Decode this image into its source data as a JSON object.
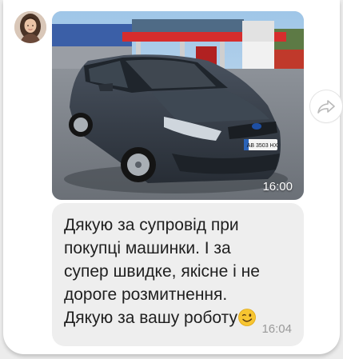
{
  "message": {
    "photo_time": "16:00",
    "text": "Дякую за супровід при\nпокупці машинки. І за\nсупер швидке, якісне і не\nдороге розмитнення.\nДякую за вашу роботу",
    "emoji": "wink-face",
    "text_time": "16:04"
  },
  "photo": {
    "license_plate": "АВ 3503 НХ"
  },
  "icons": {
    "avatar": "user-avatar",
    "forward": "forward-icon"
  },
  "colors": {
    "bubble": "#eeeeee",
    "time_muted": "#9a9a9a"
  }
}
